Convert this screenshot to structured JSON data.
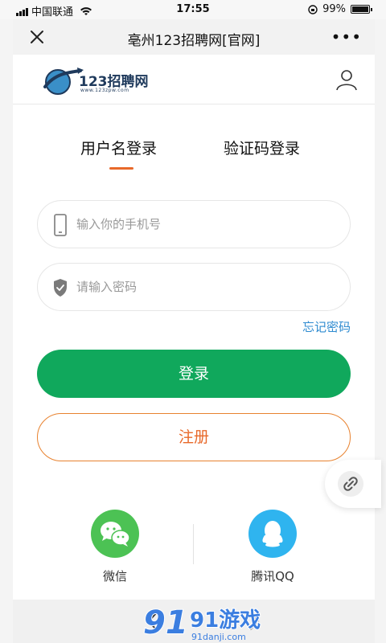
{
  "status": {
    "carrier": "中国联通",
    "time": "17:55",
    "battery": "99%",
    "battery_level": 0.99
  },
  "nav": {
    "title": "亳州123招聘网[官网]",
    "close_icon": "close-icon",
    "more_icon": "more-icon"
  },
  "header": {
    "logo_text": "123招聘网",
    "logo_url": "www.123zpw.com",
    "user_icon": "user-icon"
  },
  "tabs": [
    {
      "label": "用户名登录",
      "active": true
    },
    {
      "label": "验证码登录",
      "active": false
    }
  ],
  "form": {
    "phone_placeholder": "输入你的手机号",
    "password_placeholder": "请输入密码",
    "forgot_label": "忘记密码",
    "login_label": "登录",
    "register_label": "注册"
  },
  "social": [
    {
      "label": "微信",
      "icon": "wechat-icon"
    },
    {
      "label": "腾讯QQ",
      "icon": "qq-icon"
    }
  ],
  "watermark": {
    "text": "91游戏",
    "url": "91danji.com"
  },
  "colors": {
    "accent_orange": "#e8692a",
    "login_green": "#10a85c",
    "link_blue": "#2f8bd0",
    "wechat_green": "#4cc254",
    "qq_blue": "#2fb4ef"
  }
}
